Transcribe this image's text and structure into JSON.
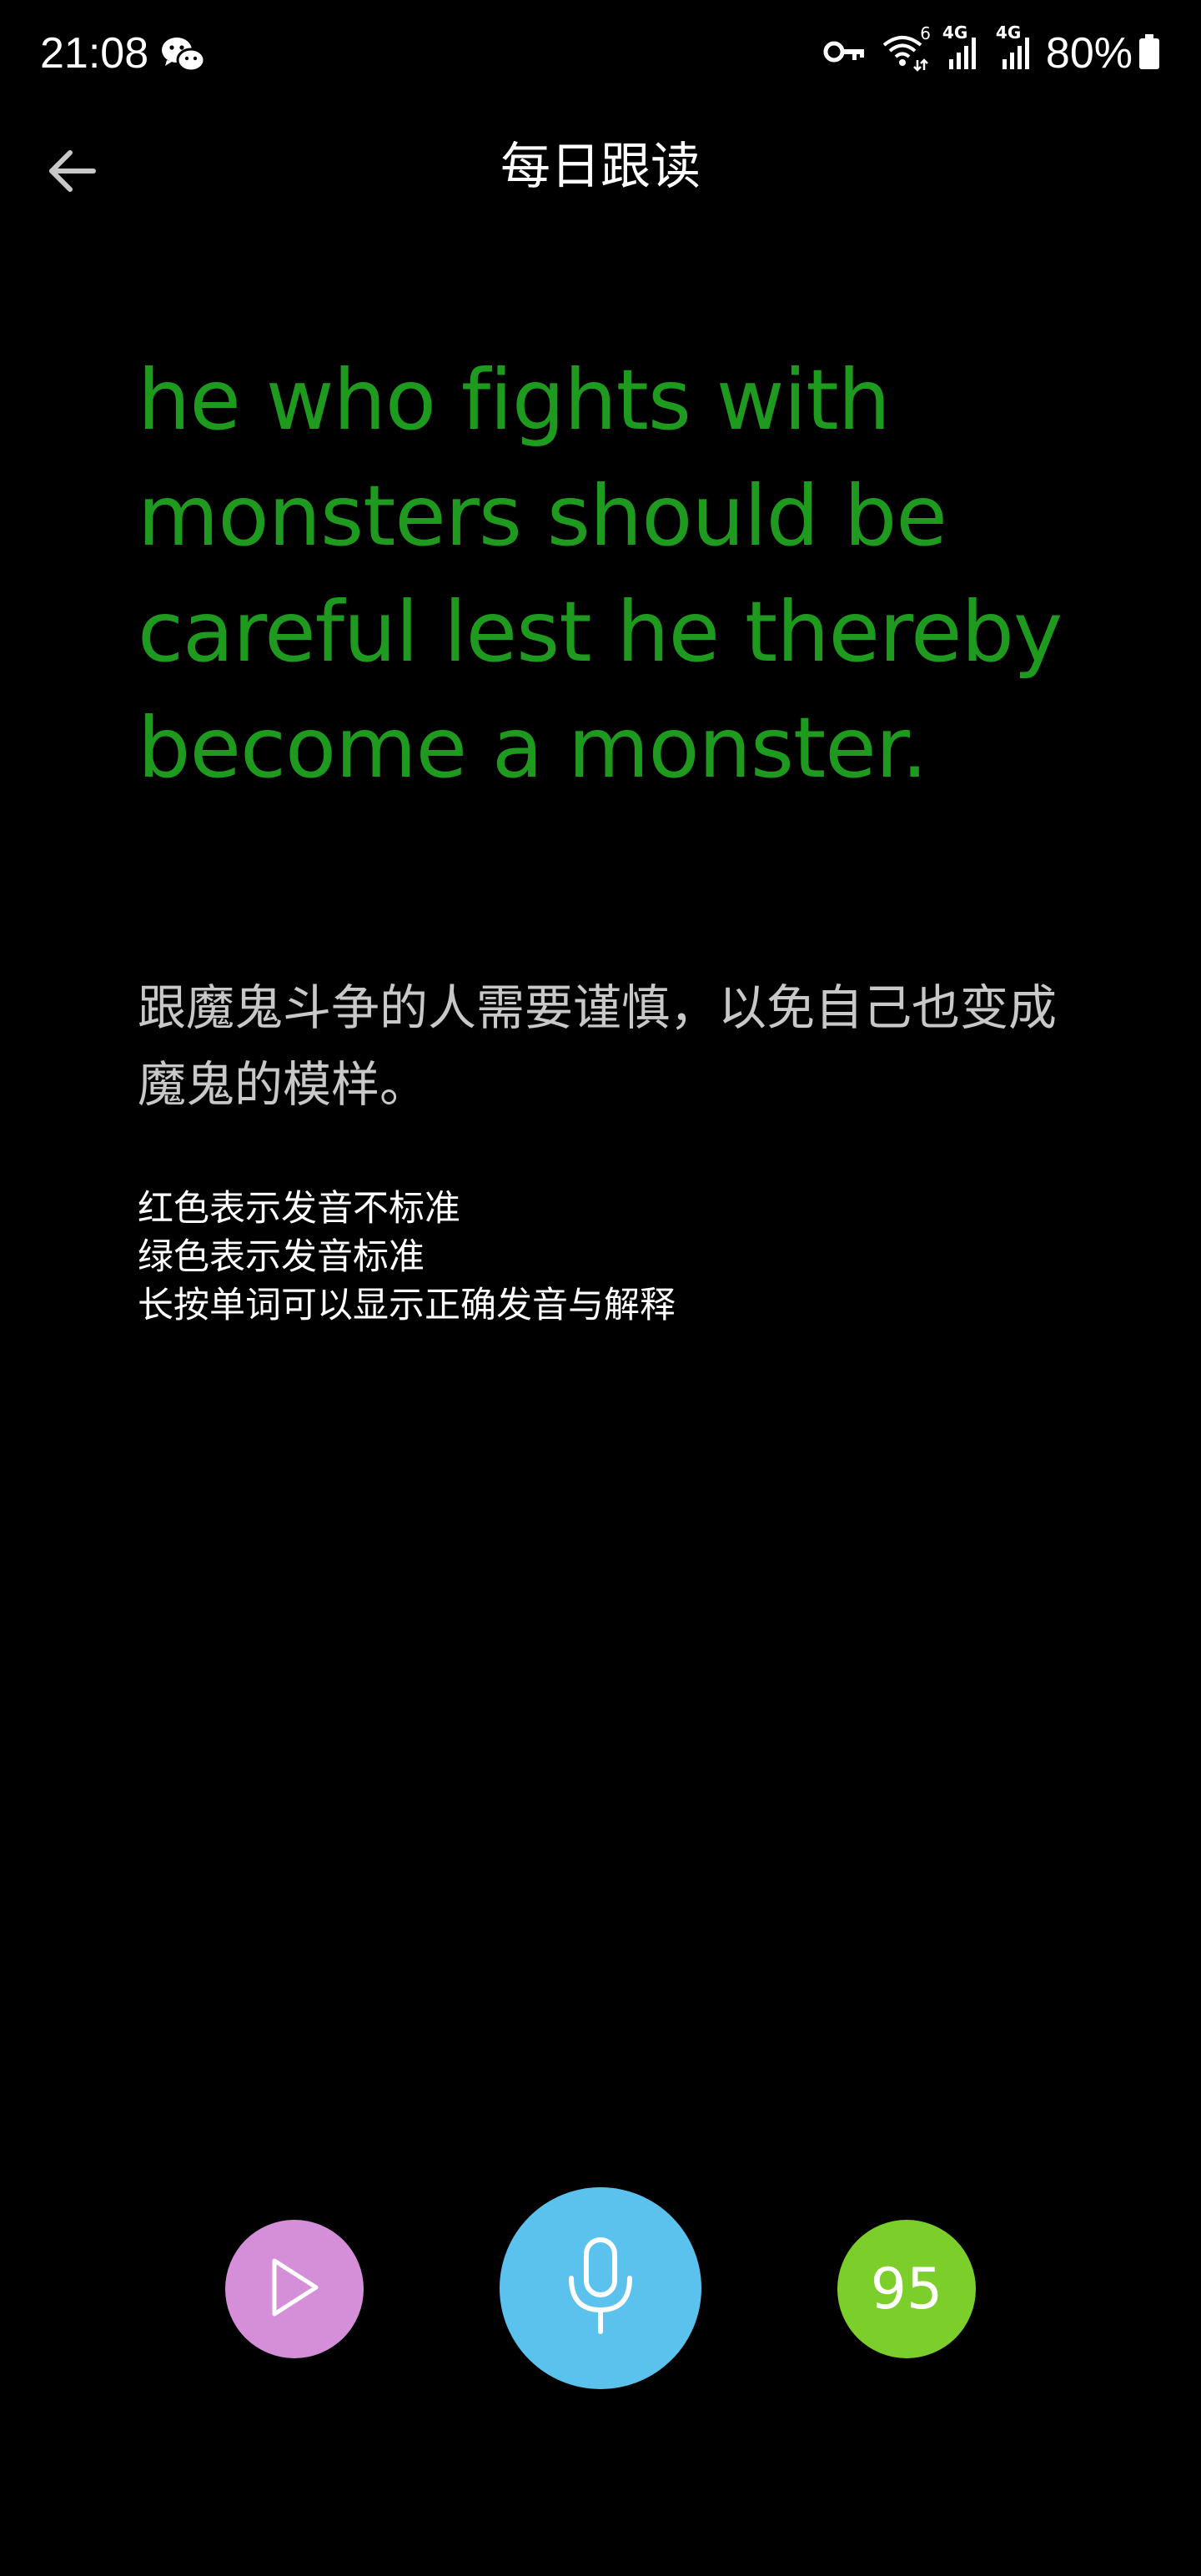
{
  "status_bar": {
    "time": "21:08",
    "battery": "80%",
    "icons": [
      "wechat-icon",
      "vpn-key-icon",
      "wifi-icon",
      "signal-4g-icon",
      "signal-4g-icon",
      "battery-icon"
    ],
    "wifi_badge": "6",
    "network_label_1": "4G",
    "network_label_2": "4G"
  },
  "header": {
    "back_icon": "arrow-left-icon",
    "title": "每日跟读"
  },
  "content": {
    "sentence_en": "he who fights with monsters should be careful lest he thereby become a monster.",
    "sentence_zh": "跟魔鬼斗争的人需要谨慎，以免自己也变成魔鬼的模样。",
    "hints": [
      "红色表示发音不标准",
      "绿色表示发音标准",
      "长按单词可以显示正确发音与解释"
    ]
  },
  "controls": {
    "play_icon": "play-icon",
    "mic_icon": "microphone-icon",
    "score": "95"
  },
  "colors": {
    "background": "#000000",
    "correct_text": "#1e9a1e",
    "translation_text": "#c8c8c8",
    "play_button": "#d58ed8",
    "mic_button": "#5bc2ee",
    "score_badge": "#7ccf2b"
  }
}
